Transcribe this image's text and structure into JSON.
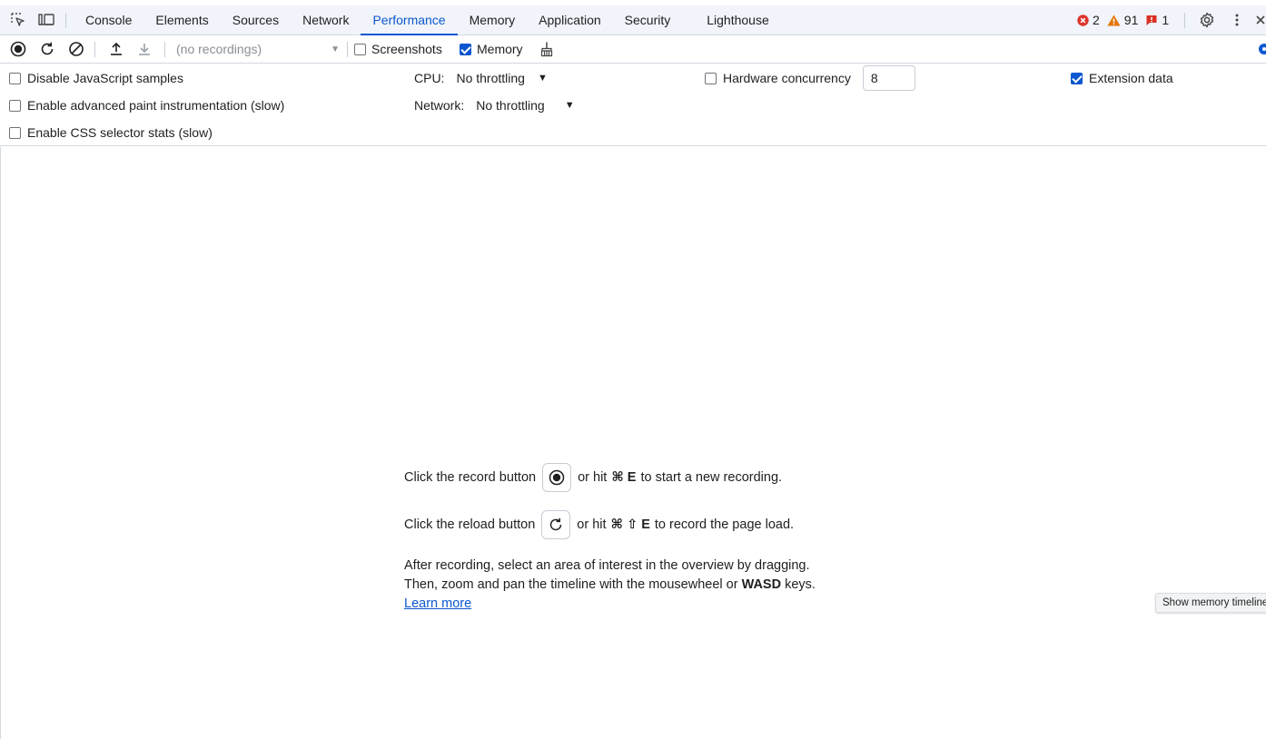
{
  "tabs": [
    {
      "label": "Console"
    },
    {
      "label": "Elements"
    },
    {
      "label": "Sources"
    },
    {
      "label": "Network"
    },
    {
      "label": "Performance"
    },
    {
      "label": "Memory"
    },
    {
      "label": "Application"
    },
    {
      "label": "Security"
    },
    {
      "label": "Lighthouse"
    }
  ],
  "active_tab": "Performance",
  "status": {
    "errors": "2",
    "warnings": "91",
    "issues": "1"
  },
  "toolbar": {
    "recordings_placeholder": "(no recordings)",
    "screenshots_label": "Screenshots",
    "screenshots_checked": false,
    "memory_label": "Memory",
    "memory_checked": true
  },
  "settings": {
    "disable_js_samples": "Disable JavaScript samples",
    "advanced_paint": "Enable advanced paint instrumentation (slow)",
    "css_selector_stats": "Enable CSS selector stats (slow)",
    "cpu_label": "CPU:",
    "cpu_value": "No throttling",
    "network_label": "Network:",
    "network_value": "No throttling",
    "hardware_concurrency_label": "Hardware concurrency",
    "hardware_concurrency_value": "8",
    "extension_data_label": "Extension data",
    "extension_data_checked": true
  },
  "landing": {
    "record_pre": "Click the record button",
    "record_post_1": "or hit",
    "record_shortcut": "⌘ E",
    "record_post_2": "to start a new recording.",
    "reload_pre": "Click the reload button",
    "reload_post_1": "or hit",
    "reload_shortcut": "⌘ ⇧ E",
    "reload_post_2": "to record the page load.",
    "para_line1": "After recording, select an area of interest in the overview by dragging.",
    "para_line2_pre": "Then, zoom and pan the timeline with the mousewheel or",
    "para_line2_bold": "WASD",
    "para_line2_post": "keys.",
    "learn_more": "Learn more"
  },
  "tooltip": "Show memory timeline",
  "colors": {
    "accent": "#0b57d0",
    "error": "#dc362e",
    "warning": "#e37400",
    "issue": "#d93025"
  }
}
